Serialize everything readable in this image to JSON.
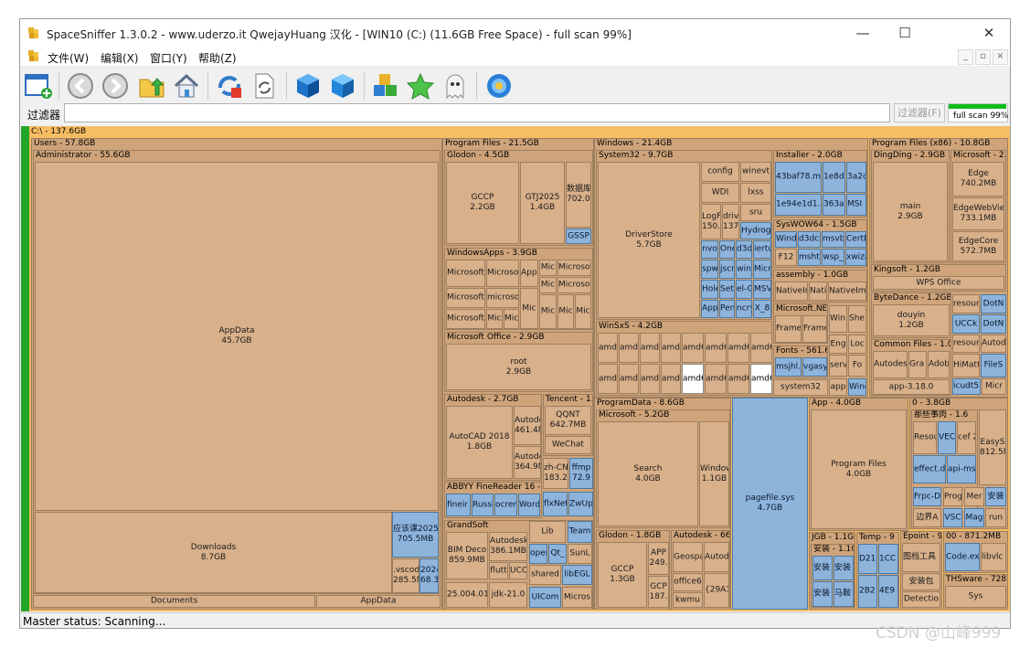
{
  "window": {
    "title": "SpaceSniffer 1.3.0.2 - www.uderzo.it  QwejayHuang 汉化 - [WIN10 (C:) (11.6GB Free Space) - full scan 99%]",
    "minimize": "—",
    "maximize": "☐",
    "close": "✕"
  },
  "menu": {
    "items": [
      "文件(W)",
      "编辑(X)",
      "窗口(Y)",
      "帮助(Z)"
    ]
  },
  "filter": {
    "label": "过滤器",
    "value": "",
    "button": "过滤器(F)"
  },
  "scan": {
    "text": "full scan 99%",
    "progress": 0.99
  },
  "status": {
    "text": "Master status: Scanning..."
  },
  "watermark": "CSDN @山峰999",
  "treemap": {
    "root": "C:\\ - 137.6GB",
    "users": "Users - 57.8GB",
    "administrator": "Administrator - 55.6GB",
    "appdata": [
      "AppData",
      "45.7GB"
    ],
    "downloads": [
      "Downloads",
      "8.7GB"
    ],
    "downloads_file1": [
      "应该课2025",
      "705.5MB"
    ],
    "downloads_file2": [
      ".vscod",
      "285.5M"
    ],
    "downloads_file3": [
      "2024",
      "68.3"
    ],
    "documents": "Documents",
    "appdata2": "AppData",
    "program_files": "Program Files - 21.5GB",
    "glodon": "Glodon - 4.5GB",
    "gccp": [
      "GCCP",
      "2.2GB"
    ],
    "gtj2025": [
      "GTJ2025",
      "1.4GB"
    ],
    "shujuku": [
      "数据库",
      "702.0M"
    ],
    "gssp": "GSSP",
    "windowsapps": "WindowsApps - 3.9GB",
    "wa_items": [
      "Microsoft.W 462.2MB",
      "Microsof 245.5ME",
      "App 125.",
      "Mic",
      "Microsof",
      "Microsoft.",
      "microsof",
      "Mic",
      "Microsof",
      "Microsoft.",
      "Mic",
      "Mic",
      "Mic",
      "Mic",
      "Mic",
      "Mic"
    ],
    "ms_office": "Microsoft Office - 2.9GB",
    "root_folder": [
      "root",
      "2.9GB"
    ],
    "autodesk": "Autodesk - 2.7GB",
    "autocad": [
      "AutoCAD 2018",
      "1.8GB"
    ],
    "autodesk_1": [
      "Autode",
      "461.4M"
    ],
    "autodesk_2": [
      "Autode",
      "364.9M"
    ],
    "tencent": "Tencent - 1.0",
    "qqnt": [
      "QQNT",
      "642.7MB"
    ],
    "wechat": "WeChat",
    "abbyy": "ABBYY FineReader 16 -",
    "abbyy_items": [
      "fineir 29.5M",
      "Russi 12.5M",
      "ocren 3.3MI",
      "Word 4KB",
      "flxNet 9.4MI",
      "ZwUp 4KB"
    ],
    "zh_cn": [
      "zh-CN",
      "183.2"
    ],
    "ffmp": [
      "ffmp",
      "72.9"
    ],
    "grandsoft": "GrandSoft",
    "bim": [
      "BIM Deco",
      "859.9MB"
    ],
    "autodesk3": [
      "Autodesk",
      "386.1MB"
    ],
    "flutt": "flutt",
    "ucc": "UCC",
    "lib": "Lib",
    "team": "Team",
    "oper": "oper",
    "qt": "Qt_",
    "sunl": "SunL",
    "shared": "shared",
    "libegl": "libEGL",
    "v25004": "25.004.010",
    "jdk": "jdk-21.0",
    "uicom": "UICom",
    "micros": "Micros",
    "windows": "Windows - 21.4GB",
    "system32": "System32 - 9.7GB",
    "driverstore": [
      "DriverStore",
      "5.7GB"
    ],
    "config": "config",
    "winevt": "winevt",
    "wdi": "WDI",
    "lxss": "lxss",
    "logf": [
      "LogF",
      "150.4"
    ],
    "drive": [
      "drive",
      "137."
    ],
    "sru": "sru",
    "hydro": "Hydrog",
    "s32_small": [
      "nvo",
      "One",
      "d3d",
      "iertu",
      "spw",
      "jscri",
      "win",
      "Micr",
      "Hole",
      "Sett",
      "el-G",
      "MSV",
      "App",
      "Pen",
      "ncry",
      "X_8"
    ],
    "installer": "Installer - 2.0GB",
    "inst_items": [
      "43baf78.ms 711.2MB",
      "1e8da 335.0",
      "3a2d 170.",
      "1e94e1d1.m",
      "363a1 28.9M",
      "MSI 12KE"
    ],
    "syswow": "SysWOW64 - 1.5GB",
    "syswow_items": [
      "Windo",
      "d3dcs",
      "msvb",
      "CertE",
      "F12",
      "mshtr",
      "wsp_",
      "xwiza"
    ],
    "assembly": "assembly - 1.0GB",
    "assembly_items": [
      "NativeIr",
      "Nati",
      "NativeIm"
    ],
    "dotnet": "Microsoft.NET",
    "dotnet_items": [
      "Frame 312.2",
      "Frame 287.2",
      "Win 8KE",
      "She 25."
    ],
    "fonts": "Fonts - 561.6",
    "fonts_items": [
      "msjhl.",
      "vgasy",
      "Eng",
      "Loc",
      "serv",
      "Fo",
      "app",
      "Winc"
    ],
    "system32_2": "system32",
    "winsxs": "WinSxS - 4.2GB",
    "winsxs_row1": [
      "amd6 194.8",
      "amd6 76.1I",
      "amd6 14.7I",
      "amd6 11.5I",
      "amd6 3.6M",
      "amd6 2.7M",
      "amd6 836K",
      "amd6 488K"
    ],
    "winsxs_row2": [
      "amd6 26.9I",
      "amd6 19.4I",
      "amd6 8.4M",
      "amd6 5.5M",
      "amd6 1.7M",
      "amd6 1.2M",
      "amd6 216K",
      "amd6 4KB"
    ],
    "programdata": "ProgramData - 8.6GB",
    "pd_microsoft": "Microsoft - 5.2GB",
    "search": [
      "Search",
      "4.0GB"
    ],
    "pd_windows": [
      "Window",
      "1.1GB"
    ],
    "pagefile": [
      "pagefile.sys",
      "4.7GB"
    ],
    "glodon2": "Glodon - 1.8GB",
    "gccp2": [
      "GCCP",
      "1.3GB"
    ],
    "app2": [
      "APP",
      "249."
    ],
    "gcp2": [
      "GCP",
      "187."
    ],
    "autodesk4": "Autodesk - 664",
    "ad4_items": [
      "Geospa 367.0M",
      "Autod 285.0I",
      "office6",
      "{29A3 6.9MB",
      "kwmu"
    ],
    "app_4": "App - 4.0GB",
    "app_pf": [
      "Program Files",
      "4.0GB"
    ],
    "jgb": "JGB - 1.1GE",
    "jgb_sub": "安装 - 1.1G",
    "jgb_items": [
      "安装 12.2M",
      "安装 9.5M",
      "安装 8.1M",
      "马鞍 8KB"
    ],
    "temp": "Temp - 9",
    "temp_items": [
      "D21 9.5M",
      "1CC 7.7I",
      "2B2 3.8M",
      "4E9 956"
    ],
    "pf86": "Program Files (x86) - 10.8GB",
    "dingding": "DingDing - 2.9GB",
    "main": [
      "main",
      "2.9GB"
    ],
    "ms2": "Microsoft - 2.0",
    "edge": [
      "Edge",
      "740.2MB"
    ],
    "edgewebview": [
      "EdgeWebVie",
      "733.1MB"
    ],
    "edgecore": [
      "EdgeCore",
      "572.7MB"
    ],
    "kingsoft": "Kingsoft - 1.2GB",
    "wps": "WPS Office",
    "bytedance": "ByteDance - 1.2GB",
    "douyin": [
      "douyin",
      "1.2GB"
    ],
    "resour1": "resour",
    "dotn1": "DotN",
    "ucck": "UCCk",
    "dotn2": "DotN",
    "common": "Common Files - 1.0",
    "common_items": [
      "Autodesk 526.1MB",
      "Gra 240",
      "Adob 1.4M",
      "resour",
      "Autod",
      "HiMatt",
      "FileS"
    ],
    "app318": "app-3.18.0",
    "icudt": "icudt53",
    "micr": "Micr",
    "zero": "0 - 3.8GB",
    "zero_sub": "那些事肉 - 1.6",
    "zero_items": [
      "Resou 374.9",
      "VEC 284.",
      "cef 255.",
      "effect.d 123.5M",
      "api-ms 16KB",
      "Frpc-D",
      "Prog",
      "Mer",
      "安装",
      "边界A",
      "VSC",
      "Mag",
      "run"
    ],
    "easys": [
      "EasyS",
      "812.5M"
    ],
    "epoint": "Epoint - 9",
    "epoint_items": [
      "图档工具 161.8M",
      "安装包",
      "Detectio"
    ],
    "oo": "00 - 871.2MB",
    "oo_items": [
      "Code.ex 169.2M",
      "libvlc 264.0"
    ],
    "thsware": "THSware - 728.",
    "sys": "Sys"
  }
}
